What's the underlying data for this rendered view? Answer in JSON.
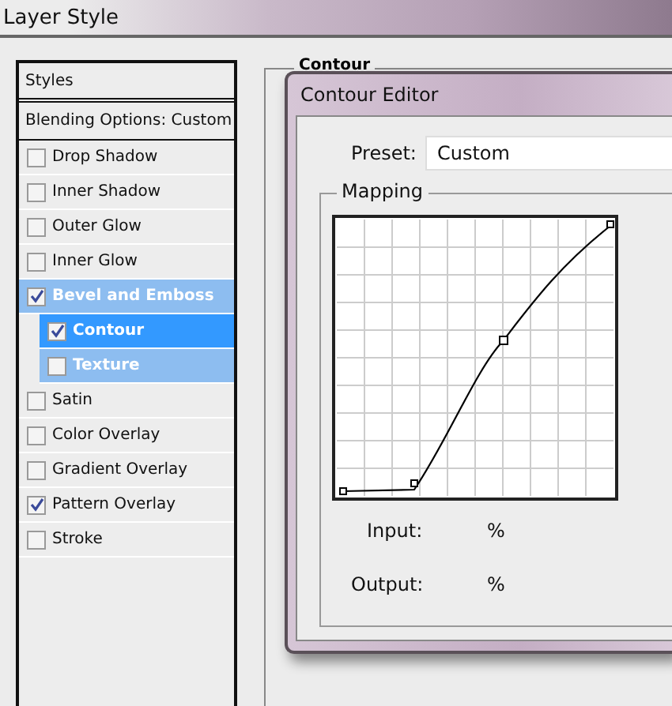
{
  "window": {
    "title": "Layer Style"
  },
  "sidebar": {
    "header": "Styles",
    "blending": "Blending Options: Custom",
    "items": [
      {
        "label": "Drop Shadow",
        "checked": false,
        "selected": false,
        "highlighted": false
      },
      {
        "label": "Inner Shadow",
        "checked": false,
        "selected": false,
        "highlighted": false
      },
      {
        "label": "Outer Glow",
        "checked": false,
        "selected": false,
        "highlighted": false
      },
      {
        "label": "Inner Glow",
        "checked": false,
        "selected": false,
        "highlighted": false
      },
      {
        "label": "Bevel and Emboss",
        "checked": true,
        "selected": false,
        "highlighted": true,
        "children": [
          {
            "label": "Contour",
            "checked": true,
            "selected": true
          },
          {
            "label": "Texture",
            "checked": false,
            "selected": false,
            "highlighted": true
          }
        ]
      },
      {
        "label": "Satin",
        "checked": false,
        "selected": false,
        "highlighted": false
      },
      {
        "label": "Color Overlay",
        "checked": false,
        "selected": false,
        "highlighted": false
      },
      {
        "label": "Gradient Overlay",
        "checked": false,
        "selected": false,
        "highlighted": false
      },
      {
        "label": "Pattern Overlay",
        "checked": true,
        "selected": false,
        "highlighted": false
      },
      {
        "label": "Stroke",
        "checked": false,
        "selected": false,
        "highlighted": false
      }
    ]
  },
  "group": {
    "title": "Contour"
  },
  "dialog": {
    "title": "Contour Editor",
    "preset_label": "Preset:",
    "preset_value": "Custom",
    "mapping_title": "Mapping",
    "input_label": "Input:",
    "input_unit": "%",
    "output_label": "Output:",
    "output_unit": "%"
  }
}
